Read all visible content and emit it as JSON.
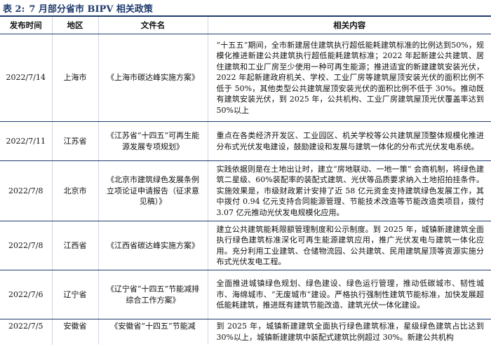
{
  "title": {
    "label": "表 2:",
    "text": "7 月部分省市 BIPV 相关政策"
  },
  "table": {
    "headers": [
      "发布时间",
      "地区",
      "文件名",
      "相关内容"
    ],
    "rows": [
      {
        "date": "2022/7/14",
        "region": "上海市",
        "file": "《上海市碳达峰实施方案》",
        "content": "“十五五”期间，全市新建居住建筑执行超低能耗建筑标准的比例达到50%，规模化推进新建公共建筑执行超低能耗建筑标准；2022 年起新建公共建筑、居住建筑和工业厂房至少使用一种可再生能源；推进适宜的新建建筑安装光伏，2022 年起新建政府机关、学校、工业厂房等建筑屋顶安装光伏的面积比例不低于 50%，其他类型公共建筑屋顶安装光伏的面积比例不低于 30%。推动既有建筑安装光伏，到 2025 年，公共机构、工业厂房建筑屋顶光伏覆盖率达到 50%以上"
      },
      {
        "date": "2022/7/11",
        "region": "江苏省",
        "file": "《江苏省“十四五”可再生能源发展专项规划》",
        "content": "重点在各类经济开发区、工业园区、机关学校等公共建筑屋顶整体规模化推进分布式光伏发电建设，鼓励建设和发展与建筑一体化的分布式光伏发电系统。"
      },
      {
        "date": "2022/7/8",
        "region": "北京市",
        "file": "《北京市建筑绿色发展条例立项论证申请报告（征求意见稿）》",
        "content": "实践依据则是在土地出让时，建立“房地联动、一地一策” 会商机制，将绿色建筑二星级、60%装配率的装配式建筑、光伏等品质要求纳入土地招拍挂条件。实施效果是，市级财政累计安排了近 58 亿元资金支持建筑绿色发展工作，其中拨付 0.94 亿元支持合同能源管理、节能技术改造等节能改造类项目，拨付 3.07 亿元推动光伏发电规模化应用。"
      },
      {
        "date": "2022/7/8",
        "region": "江西省",
        "file": "《江西省碳达峰实施方案》",
        "content": "建立公共建筑能耗限额管理制度和公示制度。到 2025 年，城镇新建建筑全面执行绿色建筑标准深化可再生能源建筑应用，推广光伏发电与建筑一体化应用。充分利用工业建筑、仓储物流园、公共建筑、民用建筑屋顶等资源实施分布式光伏发电工程。"
      },
      {
        "date": "2022/7/6",
        "region": "辽宁省",
        "file": "《辽宁省“十四五”节能减排综合工作方案》",
        "content": "全面推进城镇绿色规划、绿色建设、绿色运行管理，推动低碳城市、韧性城市、海绵城市、“无废城市”建设。严格执行强制性建筑节能标准，加快发展超低能耗建筑，推进既有建筑节能改造、建筑光伏一体化建设。"
      },
      {
        "date": "2022/7/5",
        "region": "安徽省",
        "file": "《安徽省“十四五”节能减",
        "content": "到 2025 年，城镇新建建筑全面执行绿色建筑标准，星级绿色建筑占比达到 30%以上，城镇新建建筑中装配式建筑比例超过 30%。新建公共机构"
      }
    ]
  }
}
